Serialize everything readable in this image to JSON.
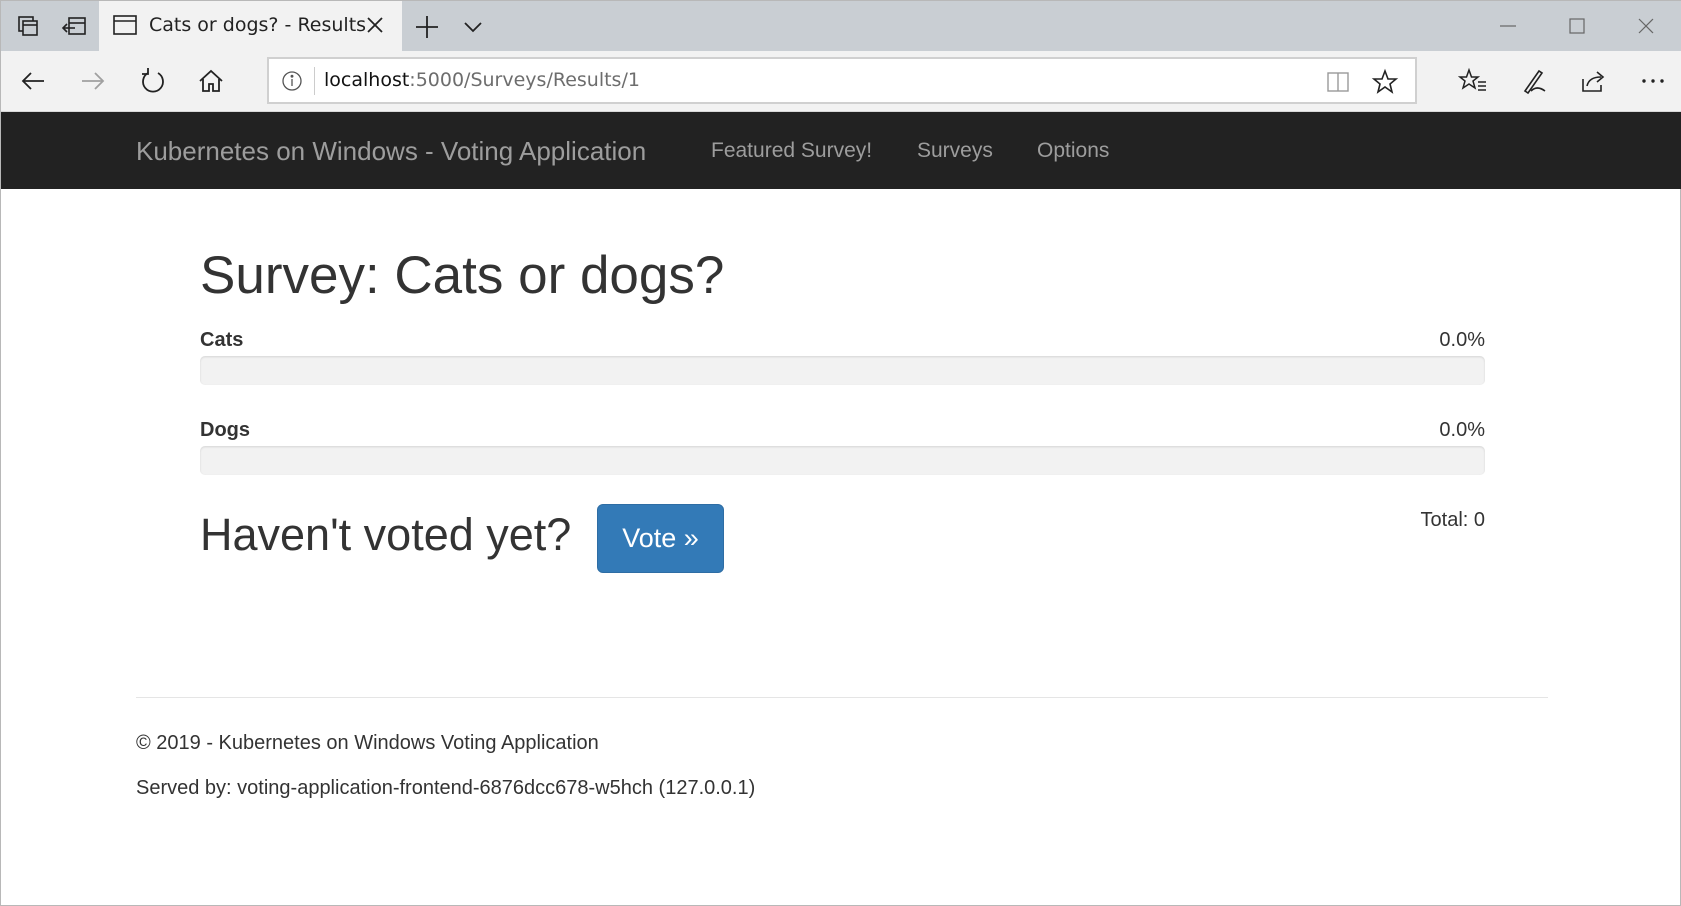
{
  "browser": {
    "tab_title": "Cats or dogs? - Results",
    "url_host": "localhost",
    "url_path": ":5000/Surveys/Results/1"
  },
  "site": {
    "brand": "Kubernetes on Windows - Voting Application",
    "nav": [
      "Featured Survey!",
      "Surveys",
      "Options"
    ]
  },
  "survey": {
    "title": "Survey: Cats or dogs?",
    "options": [
      {
        "label": "Cats",
        "percent_text": "0.0%",
        "percent": 0
      },
      {
        "label": "Dogs",
        "percent_text": "0.0%",
        "percent": 0
      }
    ],
    "prompt": "Haven't voted yet?",
    "vote_button": "Vote »",
    "total": "Total: 0"
  },
  "footer": {
    "copyright": "© 2019 - Kubernetes on Windows Voting Application",
    "served_by": "Served by: voting-application-frontend-6876dcc678-w5hch (127.0.0.1)"
  },
  "colors": {
    "navbar_bg": "#222222",
    "primary": "#337ab7"
  }
}
